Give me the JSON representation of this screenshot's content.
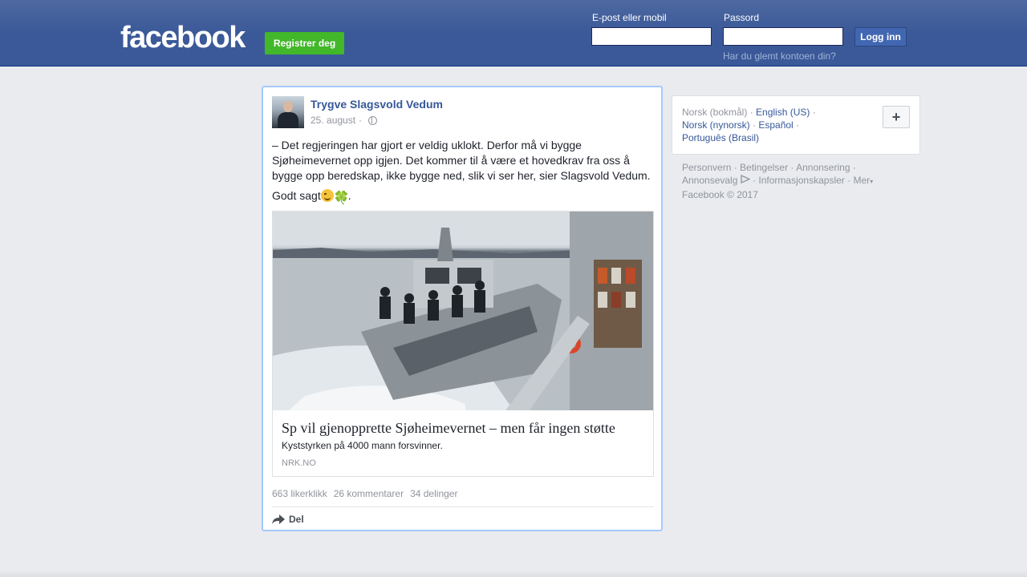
{
  "header": {
    "logo": "facebook",
    "register_label": "Registrer deg",
    "email_label": "E-post eller mobil",
    "password_label": "Passord",
    "email_value": "",
    "password_value": "",
    "login_label": "Logg inn",
    "forgot_label": "Har du glemt kontoen din?",
    "bar_color": "#3b5998",
    "register_color": "#42b72a"
  },
  "post": {
    "author": "Trygve Slagsvold Vedum",
    "date": "25. august",
    "separator": "·",
    "audience_icon": "globe-icon",
    "paragraph1": "– Det regjeringen har gjort er veldig uklokt. Derfor må vi bygge Sjøheimevernet opp igjen. Det kommer til å være et hovedkrav fra oss å bygge opp beredskap, ikke bygge ned, slik vi ser her, sier Slagsvold Vedum.",
    "paragraph2_text": "Godt sagt",
    "paragraph2_end": ".",
    "emoji1": "winking-face-emoji",
    "emoji2": "four-leaf-clover-emoji",
    "link": {
      "title": "Sp vil gjenopprette Sjøheimevernet – men får ingen støtte",
      "description": "Kyststyrken på 4000 mann forsvinner.",
      "domain": "NRK.NO"
    },
    "stats": {
      "likes": "663 likerklikk",
      "comments": "26 kommentarer",
      "shares": "34 delinger"
    },
    "share_label": "Del",
    "highlight_color": "#a6c8ff"
  },
  "languages": {
    "current": "Norsk (bokmål)",
    "items": [
      "English (US)",
      "Norsk (nynorsk)",
      "Español",
      "Português (Brasil)"
    ],
    "more_icon": "plus-icon"
  },
  "footer": {
    "links": [
      "Personvern",
      "Betingelser",
      "Annonsering",
      "Annonsevalg",
      "Informasjonskapsler",
      "Mer"
    ],
    "copyright": "Facebook © 2017"
  }
}
